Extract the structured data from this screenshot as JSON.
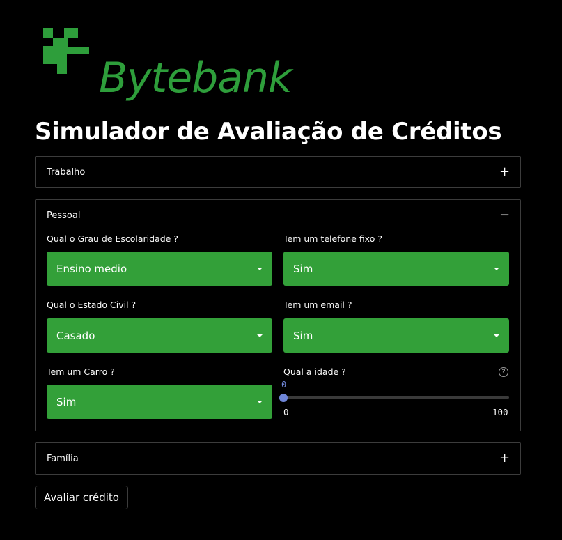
{
  "brand": {
    "name": "Bytebank",
    "color": "#2e9e3b"
  },
  "page_title": "Simulador de Avaliação de Créditos",
  "sections": {
    "trabalho": {
      "title": "Trabalho",
      "toggle": "+"
    },
    "pessoal": {
      "title": "Pessoal",
      "toggle": "−",
      "escolaridade": {
        "label": "Qual o Grau de Escolaridade ?",
        "value": "Ensino medio"
      },
      "telefone": {
        "label": "Tem um telefone fixo ?",
        "value": "Sim"
      },
      "estado_civil": {
        "label": "Qual o Estado Civil ?",
        "value": "Casado"
      },
      "email": {
        "label": "Tem um email ?",
        "value": "Sim"
      },
      "carro": {
        "label": "Tem um Carro ?",
        "value": "Sim"
      },
      "idade": {
        "label": "Qual a idade ?",
        "value": "0",
        "min": "0",
        "max": "100",
        "help_icon": "question-circle-icon"
      }
    },
    "familia": {
      "title": "Família",
      "toggle": "+"
    }
  },
  "submit_label": "Avaliar crédito",
  "colors": {
    "accent": "#33a039",
    "slider": "#6f86d8",
    "background": "#000000"
  }
}
